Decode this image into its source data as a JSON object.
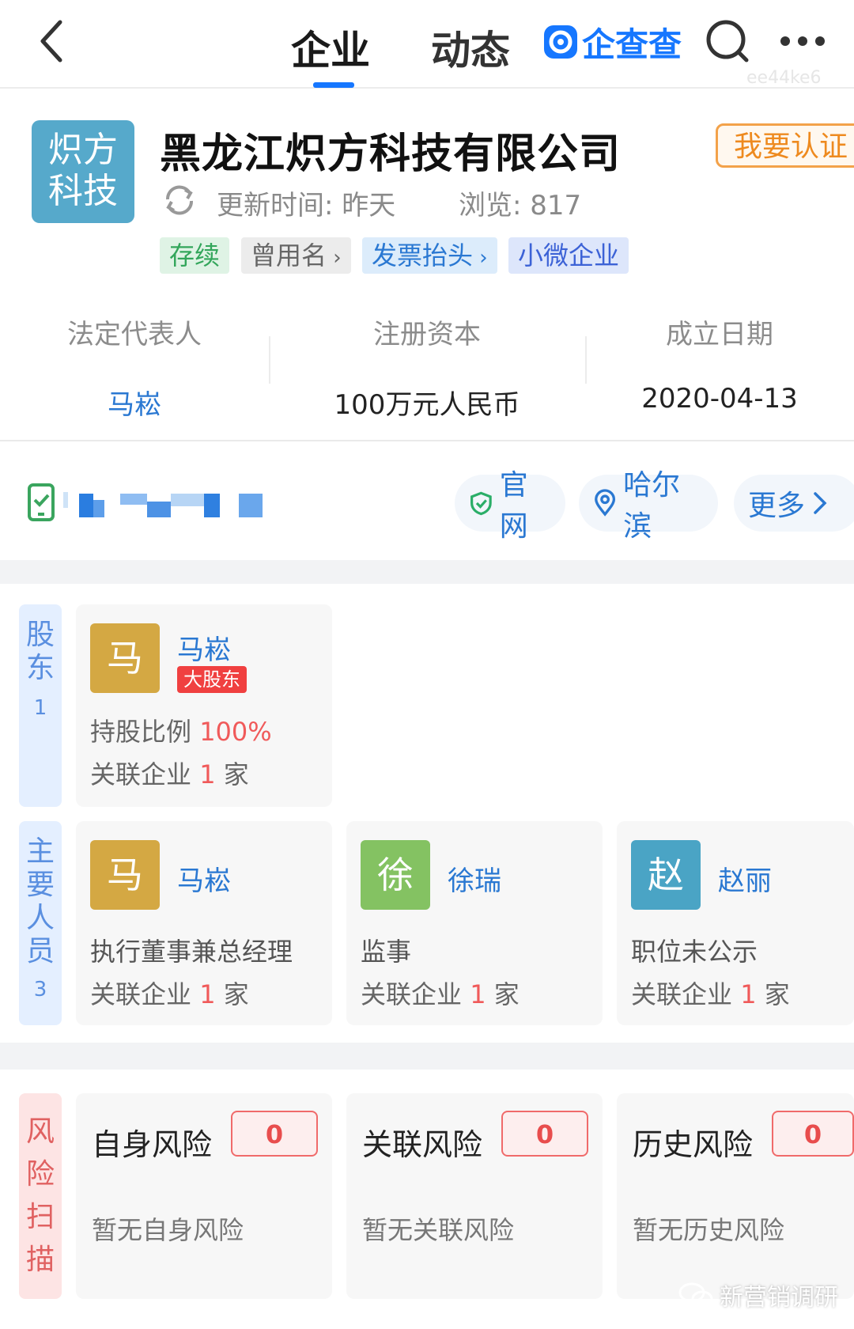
{
  "nav": {
    "tabs": [
      {
        "label": "企业"
      },
      {
        "label": "动态"
      }
    ],
    "brand": "企查查",
    "watermark": "ee44ke6"
  },
  "company": {
    "logo_text": [
      "炽方",
      "科技"
    ],
    "name": "黑龙江炽方科技有限公司",
    "cert_button": "我要认证",
    "update_time": "更新时间: 昨天",
    "views": "浏览: 817",
    "tags": [
      "存续",
      "曾用名",
      "发票抬头",
      "小微企业"
    ]
  },
  "basic_info": [
    {
      "label": "法定代表人",
      "value": "马崧",
      "link": true
    },
    {
      "label": "注册资本",
      "value": "100万元人民币",
      "link": false
    },
    {
      "label": "成立日期",
      "value": "2020-04-13",
      "link": false
    }
  ],
  "contact": {
    "chips": [
      {
        "icon": "shield-check-icon",
        "label": "官网"
      },
      {
        "icon": "location-pin-icon",
        "label": "哈尔滨"
      },
      {
        "icon": "chevron-right-icon",
        "label": "更多"
      }
    ]
  },
  "shareholders": {
    "side_label": [
      "股",
      "东"
    ],
    "count": "1",
    "items": [
      {
        "avatar_char": "马",
        "name": "马崧",
        "badge": "大股东",
        "ratio_label": "持股比例",
        "ratio_value": "100%",
        "related_label": "关联企业",
        "related_count": "1",
        "related_unit": "家"
      }
    ]
  },
  "key_people": {
    "side_label": [
      "主",
      "要",
      "人",
      "员"
    ],
    "count": "3",
    "items": [
      {
        "avatar_char": "马",
        "name": "马崧",
        "role": "执行董事兼总经理",
        "related_label": "关联企业",
        "related_count": "1",
        "related_unit": "家",
        "color": "#d4a843"
      },
      {
        "avatar_char": "徐",
        "name": "徐瑞",
        "role": "监事",
        "related_label": "关联企业",
        "related_count": "1",
        "related_unit": "家",
        "color": "#84c262"
      },
      {
        "avatar_char": "赵",
        "name": "赵丽",
        "role": "职位未公示",
        "related_label": "关联企业",
        "related_count": "1",
        "related_unit": "家",
        "color": "#4aa4c5"
      }
    ]
  },
  "risk_scan": {
    "side_label": [
      "风",
      "险",
      "扫",
      "描"
    ],
    "items": [
      {
        "title": "自身风险",
        "count": "0",
        "desc": "暂无自身风险"
      },
      {
        "title": "关联风险",
        "count": "0",
        "desc": "暂无关联风险"
      },
      {
        "title": "历史风险",
        "count": "0",
        "desc": "暂无历史风险"
      }
    ]
  },
  "footer_watermark": "新营销调研"
}
